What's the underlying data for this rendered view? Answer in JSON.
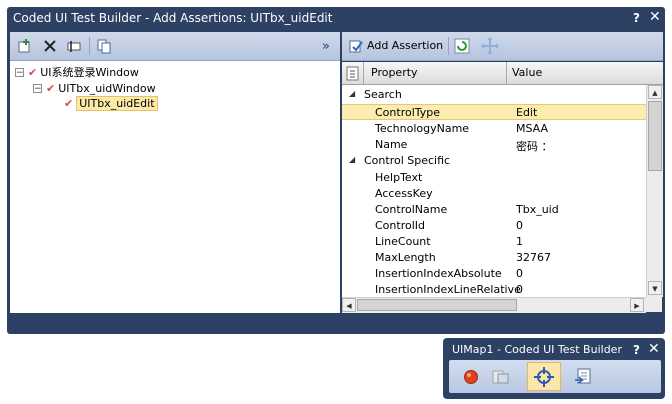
{
  "main_window": {
    "title": "Coded UI Test Builder - Add Assertions: UITbx_uidEdit",
    "help": "?",
    "close": "✕"
  },
  "left_toolbar": {
    "icons": [
      "add-control-icon",
      "delete-icon",
      "rename-icon",
      "copy-icon"
    ],
    "collapse": "»"
  },
  "tree": [
    {
      "label": "UI系统登录Window",
      "expander": "⊟"
    },
    {
      "label": "UITbx_uidWindow",
      "expander": "⊟"
    },
    {
      "label": "UITbx_uidEdit"
    }
  ],
  "right_toolbar": {
    "add_assertion": "Add Assertion",
    "icons": [
      "refresh-icon",
      "move-icon"
    ]
  },
  "grid": {
    "col_property": "Property",
    "col_value": "Value",
    "cat_search": "Search",
    "cat_control_specific": "Control Specific",
    "search_rows": [
      {
        "name": "ControlType",
        "value": "Edit"
      },
      {
        "name": "TechnologyName",
        "value": "MSAA"
      },
      {
        "name": "Name",
        "value": "密码 ："
      }
    ],
    "specific_rows": [
      {
        "name": "HelpText",
        "value": ""
      },
      {
        "name": "AccessKey",
        "value": ""
      },
      {
        "name": "ControlName",
        "value": "Tbx_uid"
      },
      {
        "name": "ControlId",
        "value": "0"
      },
      {
        "name": "LineCount",
        "value": "1"
      },
      {
        "name": "MaxLength",
        "value": "32767"
      },
      {
        "name": "InsertionIndexAbsolute",
        "value": "0"
      },
      {
        "name": "InsertionIndexLineRelative",
        "value": "0"
      }
    ]
  },
  "float_window": {
    "title": "UIMap1 - Coded UI Test Builder",
    "help": "?",
    "close": "✕",
    "icons": [
      "record-icon",
      "show-steps-icon",
      "crosshair-icon",
      "generate-code-icon"
    ]
  },
  "colors": {
    "frame": "#2c4163",
    "toolbar": "#c4d0e6",
    "highlight": "#fdecb0"
  }
}
